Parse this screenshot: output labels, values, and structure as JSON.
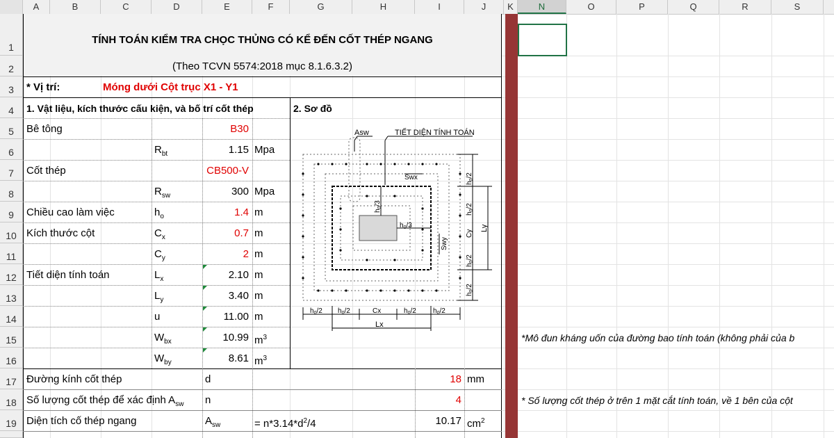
{
  "columns": [
    "A",
    "B",
    "C",
    "D",
    "E",
    "F",
    "G",
    "H",
    "I",
    "J",
    "K",
    "N",
    "O",
    "P",
    "Q",
    "R",
    "S"
  ],
  "rows": [
    "1",
    "2",
    "3",
    "4",
    "5",
    "6",
    "7",
    "8",
    "9",
    "10",
    "11",
    "12",
    "13",
    "14",
    "15",
    "16",
    "17",
    "18",
    "19"
  ],
  "sheet": {
    "title": "TÍNH TOÁN KIỂM TRA CHỌC THỦNG CÓ KỂ ĐẾN CỐT THÉP NGANG",
    "subtitle": "(Theo TCVN 5574:2018 mục 8.1.6.3.2)",
    "location_label": "* Vị trí:",
    "location_value": "Móng dưới Cột trục X1 - Y1",
    "section1": "1. Vật liệu, kích thước cấu kiện, và bố trí cốt thép",
    "section2": "2. Sơ đồ",
    "concrete_label": "Bê tông",
    "concrete_value": "B30",
    "rbt_sym": "R",
    "rbt_sub": "bt",
    "rbt_value": "1.15",
    "rbt_unit": "Mpa",
    "steel_label": "Cốt thép",
    "steel_value": "CB500-V",
    "rsw_sym": "R",
    "rsw_sub": "sw",
    "rsw_value": "300",
    "rsw_unit": "Mpa",
    "h0_label": "Chiều cao làm việc",
    "h0_sym": "h",
    "h0_sub": "o",
    "h0_value": "1.4",
    "h0_unit": "m",
    "col_label": "Kích thước cột",
    "cx_sym": "C",
    "cx_sub": "x",
    "cx_value": "0.7",
    "cx_unit": "m",
    "cy_sym": "C",
    "cy_sub": "y",
    "cy_value": "2",
    "cy_unit": "m",
    "sec_label": "Tiết diện tính toán",
    "lx_sym": "L",
    "lx_sub": "x",
    "lx_value": "2.10",
    "lx_unit": "m",
    "ly_sym": "L",
    "ly_sub": "y",
    "ly_value": "3.40",
    "ly_unit": "m",
    "u_sym": "u",
    "u_value": "11.00",
    "u_unit": "m",
    "wbx_sym": "W",
    "wbx_sub": "bx",
    "wbx_value": "10.99",
    "wbx_unit": "m",
    "wbx_unit_sup": "3",
    "wby_sym": "W",
    "wby_sub": "by",
    "wby_value": "8.61",
    "wby_unit": "m",
    "wby_unit_sup": "3",
    "d_label": "Đường kính cốt thép",
    "d_sym": "d",
    "d_value": "18",
    "d_unit": "mm",
    "n_label": "Số lượng cốt thép để xác định A",
    "n_label_sub": "sw",
    "n_sym": "n",
    "n_value": "4",
    "asw_label": "Diện tích cố thép ngang",
    "asw_sym": "A",
    "asw_sub": "sw",
    "asw_formula": "= n*3.14*d",
    "asw_formula_sup": "2",
    "asw_formula_tail": "/4",
    "asw_value": "10.17",
    "asw_unit": "cm",
    "asw_unit_sup": "2",
    "note1": "*Mô đun kháng uốn của đường bao tính toán (không phải của b",
    "note2": "* Số lượng cốt thép ở trên 1 mặt cắt tính toán, về 1 bên của cột"
  },
  "diagram": {
    "asw": "Asw",
    "tiet_dien": "TIẾT DIỆN TÍNH TOÁN",
    "swx": "Swx",
    "swy": "Swy",
    "h0_3": "h",
    "h0_3_sub": "0",
    "h0_3_tail": "/3",
    "h0_2": "h",
    "h0_2_sub": "0",
    "h0_2_tail": "/2",
    "cx": "Cx",
    "cy": "Cy",
    "lx": "Lx",
    "ly": "Ly"
  }
}
